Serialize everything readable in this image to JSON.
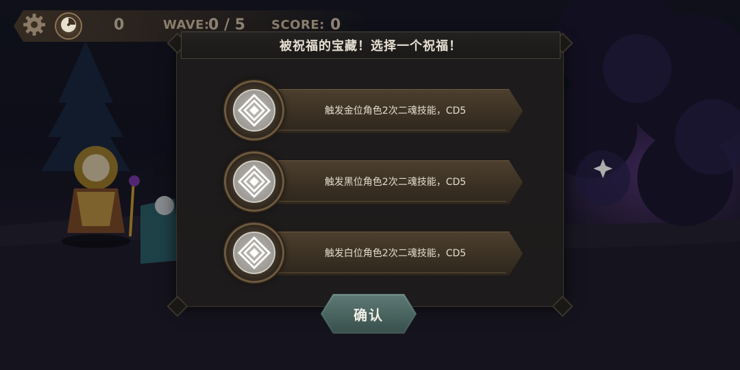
{
  "hud": {
    "settings_icon": "gear-icon",
    "speed_icon": "clock-icon",
    "gold_value": "0",
    "wave_label": "WAVE:",
    "wave_value": "0 / 5",
    "score_label": "SCORE:",
    "score_value": "0"
  },
  "modal": {
    "title": "被祝福的宝藏！选择一个祝福！",
    "options": [
      {
        "icon": "diamond-emblem-icon",
        "label": "触发金位角色2次二魂技能，CD5"
      },
      {
        "icon": "diamond-emblem-icon",
        "label": "触发黑位角色2次二魂技能，CD5"
      },
      {
        "icon": "diamond-emblem-icon",
        "label": "触发白位角色2次二魂技能，CD5"
      }
    ],
    "confirm_label": "确认"
  },
  "colors": {
    "panel": "#1e1c1b",
    "option_bar": "#4d3f2e",
    "emblem": "#9d9a95",
    "confirm": "#4f6b67",
    "title_text": "#e6dfd2"
  }
}
